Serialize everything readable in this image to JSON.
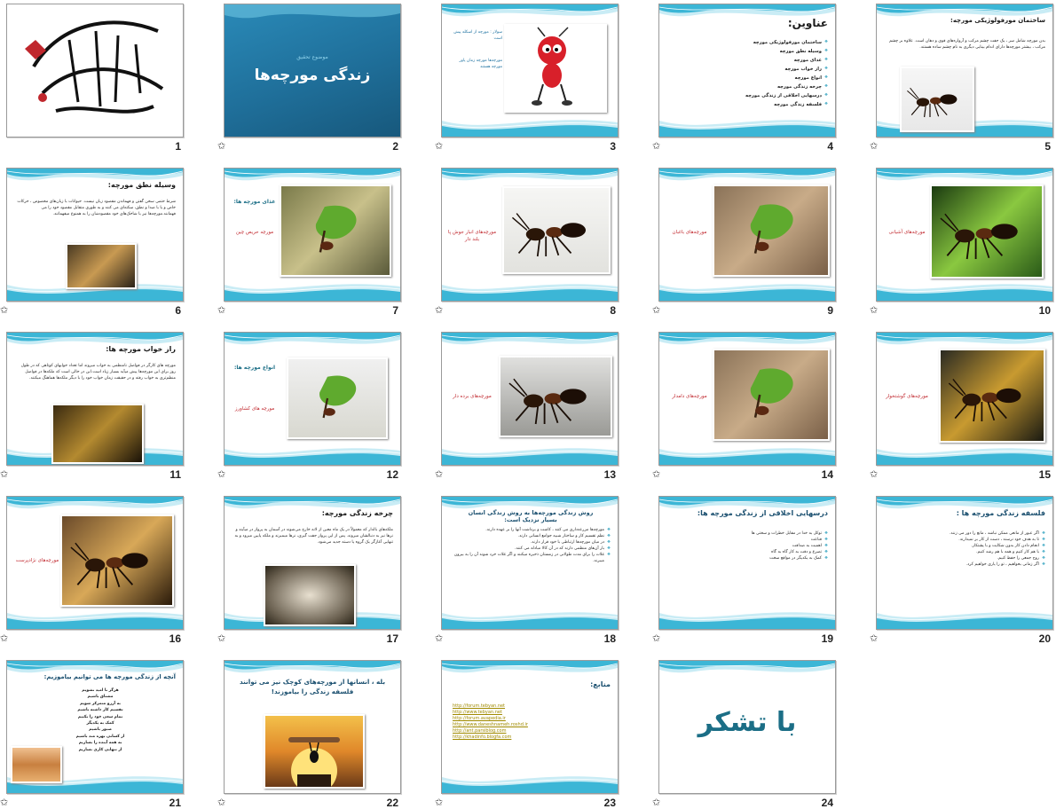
{
  "slides": [
    {
      "num": "1",
      "type": "calligraphy",
      "calligraphy_text": "بسم الله الرحمن الرحیم"
    },
    {
      "num": "2",
      "type": "title",
      "subtitle": "موضوع تحقیق",
      "title": "زندگی مورچه‌ها"
    },
    {
      "num": "3",
      "type": "intro",
      "caption_a": "سولار : مورچه از اسکله پیش است",
      "caption_b": "مورچه‌ها مورچه زمان پاور مورچه هستند"
    },
    {
      "num": "4",
      "type": "list",
      "title": "عناوین:",
      "items": [
        "ساختمان مورفولوژیکی مورچه",
        "وسیله نطق مورچه",
        "غذای مورچه",
        "راز خواب مورچه",
        "انواع مورچه",
        "چرخه زندگی مورچه",
        "درسهایی اخلاقی از زندگی مورچه",
        "فلسفه زندگی مورچه"
      ]
    },
    {
      "num": "5",
      "type": "text-img",
      "title": "ساختمان مورفولوژیکی مورچه:",
      "body": "بدن مورچه شامل سر ، یک جفت چشم مرکب و آرواره‌های قوی و دهان است. علاوه بر چشم مرکب ، بیشتر مورچه‌ها دارای اندام بینایی دیگری به نام چشم ساده هستند."
    },
    {
      "num": "6",
      "type": "text-img",
      "title": "وسیله نطق مورچه:",
      "body": "شرط حتمی سخن گفتن و فهماندن مقصود زبان نیست. حیوانات با زبان‌های مخصوص ، حرکات خاص و یا با صدا و نطق، سکته‌ای می کنند و به طوری متقابل مقصود خود را می فهمانند.مورچه‌ها نیز با شاخک‌های خود مقصودشان را به همنوع میفهمانند."
    },
    {
      "num": "7",
      "type": "photo-caption",
      "title": "غذای مورچه ها:",
      "caption": "مورچه حریص چین"
    },
    {
      "num": "8",
      "type": "photo-caption",
      "caption": "مورچه‌های انبار جوش پا بلند دار"
    },
    {
      "num": "9",
      "type": "photo-caption",
      "caption": "مورچه‌های باغبان"
    },
    {
      "num": "10",
      "type": "photo-caption",
      "caption": "مورچه‌های آشیانی"
    },
    {
      "num": "11",
      "type": "text-img",
      "title": "راز خواب مورچه ها:",
      "body": "مورچه های کارگر در فواصل نامنظمی به خواب میروند اما تعداد خوابهای کوتاهی که در طول روز برای این مورچه‌ها پیش میآید بسیار زیاد است.این در حالی است که ملکه‌ها در فواصل منظم‌تری به خواب رفته و در حقیقت زمان خواب خود را با دیگر ملکه‌ها هماهنگ میکنند."
    },
    {
      "num": "12",
      "type": "photo-caption",
      "title": "انواع مورچه ها:",
      "caption": "مورچه های کشاورز"
    },
    {
      "num": "13",
      "type": "photo-caption",
      "caption": "مورچه‌های برده دار"
    },
    {
      "num": "14",
      "type": "photo-caption",
      "caption": "مورچه‌های دامدار"
    },
    {
      "num": "15",
      "type": "photo-caption",
      "caption": "مورچه‌های گوشتخوار"
    },
    {
      "num": "16",
      "type": "photo-caption",
      "caption": "مورچه‌های نژادپرست"
    },
    {
      "num": "17",
      "type": "text-img",
      "title": "چرخه زندگی مورچه:",
      "body": "ملکه‌های بالدار که معمولاً در یک ماه معین از لانه خارج می‌شوند در آسمان به پرواز در میآیند و نرها نیز به دنبالشان میروند. پس از این پرواز جفت گیری، نرها میمیرند و ملکه پایین میرود و به تنهایی آغازگر یک گروه یا دسته جدید می‌شود."
    },
    {
      "num": "18",
      "type": "list",
      "title": "روش زندگی مورچه‌ها به روش زندگی انسان بسیار نزدیک است:",
      "items": [
        "مورچه‌ها مزرعه‌داری می کنند ، کاشت و برداشت آنها را بر عهده دارند.",
        "نظم تقسیم کار و ساختار شبیه جوامع انسانی دارند.",
        "در میان مورچه‌ها ارتباطی با خود قرار دارند.",
        "بار آن‌ها‌ی منظمی دارند که در آن کالا مبادله می کنند.",
        "غلات را برای مدت طولانی در زمستان ذخیره میکنند و اگر غلات خرد شوند آن را به بیرون میبرند."
      ]
    },
    {
      "num": "19",
      "type": "list",
      "title": "درسهایی اخلاقی از زندگی مورچه ها:",
      "items": [
        "توکل به خدا در مقابل خطرات و سختی ها",
        "قناعت",
        "اهمیت به صداقت",
        "تصرع و دقت به کار گاه به گاه",
        "کمک به یکدیگر در مواقع سخت"
      ]
    },
    {
      "num": "20",
      "type": "list",
      "title": "فلسفه زندگی مورچه ها :",
      "items": [
        "اگر عبور از مانعی ممکن نباشد ، مانع را دور می زنند.",
        "تا به هدف خود نرسند ، دست از کار بر نمیدارند.",
        "انجام دادن کار بدون شکایت و با پشتکار.",
        "با هم کار کنیم و همه با هم رشد کنیم.",
        "روح جمعی را حفظ کنیم.",
        "اگر زمانی بخواهیم ، تو را یاری خواهیم کرد."
      ]
    },
    {
      "num": "21",
      "type": "poem",
      "title": "آنچه از زندگی مورچه ها می توانیم بیاموزیم:",
      "lines": [
        "هرگز نا امید نشویم",
        "مشتاق باشیم",
        "به آرزو متمرکز شویم",
        "تقسیم کار داشته باشیم",
        "تمام سعی خود را بکنیم",
        "کمک به یکدیگر",
        "صبور باشیم",
        "از کسانی بهره مند باشیم",
        "به همه آینده را بسازیم",
        "از تنهایی کاری نسازیم"
      ]
    },
    {
      "num": "22",
      "type": "closing-photo",
      "title": "بله ، انسانها از مورچه‌های کوچک نیز می توانند فلسفه زندگی را بیاموزند!"
    },
    {
      "num": "23",
      "type": "links",
      "title": "منابع:",
      "links": [
        "http://forum.tebyan.net",
        "http://www.tebyan.net",
        "http://forum.avapedia.ir",
        "http://www.daneshnameh.roshd.ir",
        "http://ant.parsiblog.com",
        "http://khadinfo.blogfa.com"
      ]
    },
    {
      "num": "24",
      "type": "thanks",
      "title": "با تشکر"
    }
  ]
}
